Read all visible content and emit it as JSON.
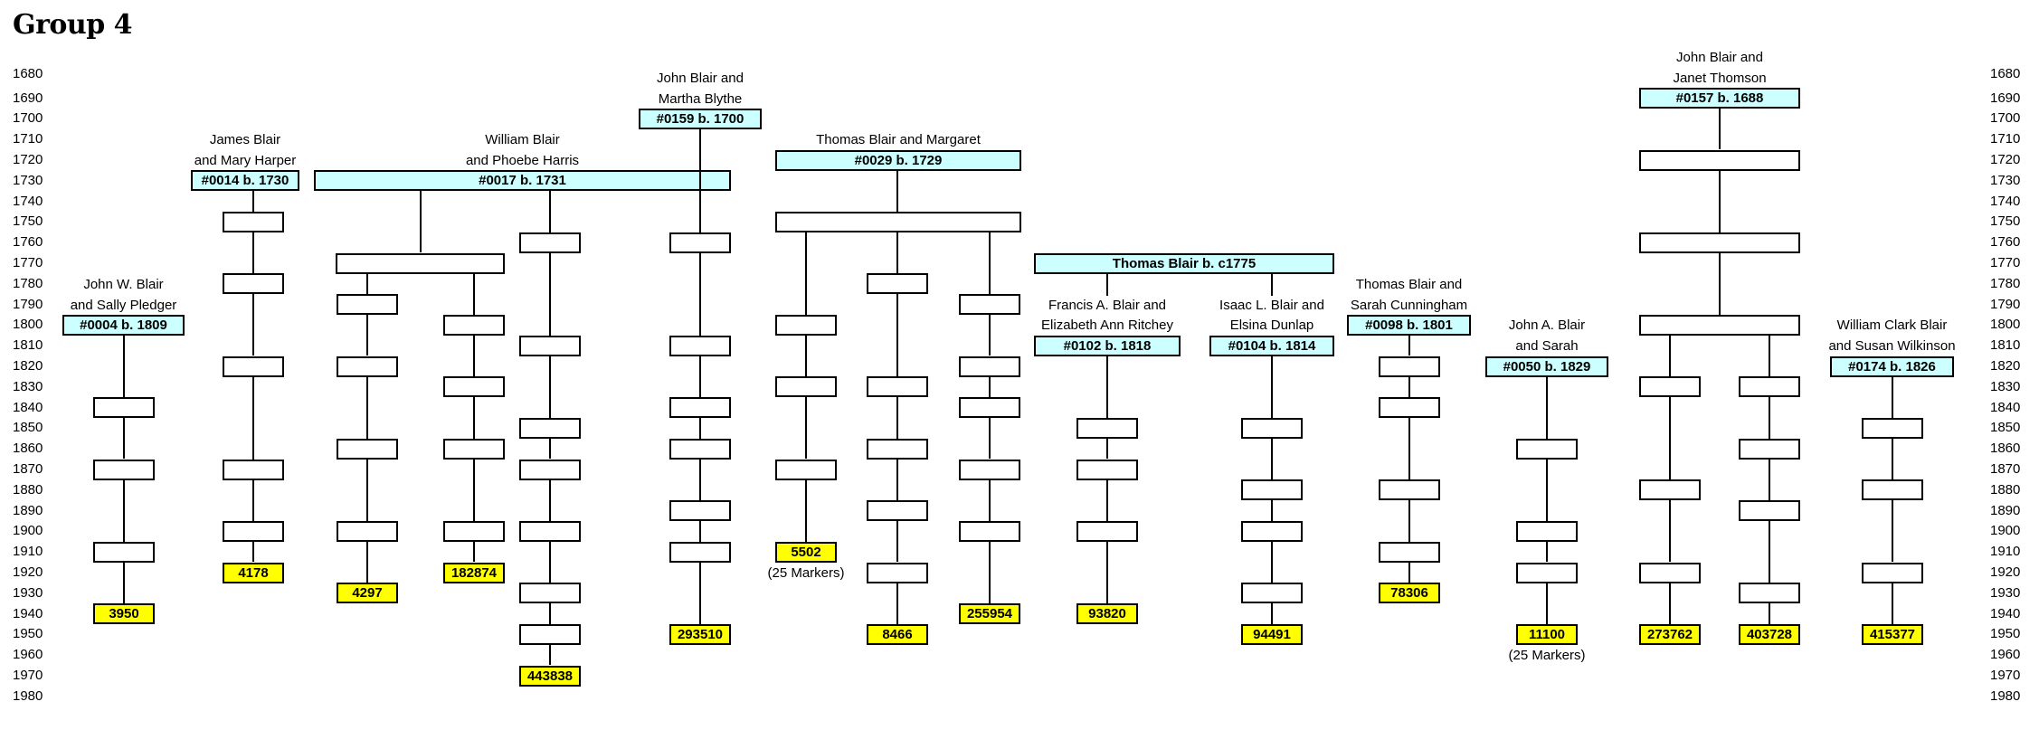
{
  "title": "Group 4",
  "years": [
    1680,
    1690,
    1700,
    1710,
    1720,
    1730,
    1740,
    1750,
    1760,
    1770,
    1780,
    1790,
    1800,
    1810,
    1820,
    1830,
    1840,
    1850,
    1860,
    1870,
    1880,
    1890,
    1900,
    1910,
    1920,
    1930,
    1940,
    1950,
    1960,
    1970,
    1980
  ],
  "colors": {
    "person_fill": "#ccffff",
    "kit_fill": "#ffff00",
    "generation_fill": "#ffffff",
    "line": "#000000"
  },
  "lineages": [
    {
      "id": "c1",
      "couple": [
        "John W. Blair",
        "and Sally Pledger"
      ],
      "ancestor": "#0004 b. 1809",
      "ancestor_year": 1800,
      "label_years": [
        1780,
        1790
      ],
      "generations": [
        1840,
        1870,
        1910
      ],
      "kit": "3950",
      "kit_year": 1940
    },
    {
      "id": "c2",
      "couple": [
        "James Blair",
        "and Mary Harper"
      ],
      "ancestor": "#0014 b. 1730",
      "ancestor_year": 1730,
      "label_years": [
        1710,
        1720
      ],
      "generations": [
        1750,
        1780,
        1820,
        1870,
        1900
      ],
      "kit": "4178",
      "kit_year": 1920
    },
    {
      "id": "g0017",
      "couple": [
        "William Blair",
        "and Phoebe Harris"
      ],
      "ancestor": "#0017 b. 1731",
      "ancestor_year": 1730,
      "label_years": [
        1710,
        1720
      ],
      "split_year": 1770,
      "branches": [
        {
          "id": "c3",
          "generations": [
            1790,
            1820,
            1860,
            1900
          ],
          "kit": "4297",
          "kit_year": 1930
        },
        {
          "id": "c4",
          "generations": [
            1800,
            1830,
            1860,
            1900
          ],
          "kit": "182874",
          "kit_year": 1920
        }
      ],
      "direct": {
        "id": "c5",
        "generations": [
          1760,
          1810,
          1850,
          1870,
          1900,
          1930,
          1950
        ],
        "kit": "443838",
        "kit_year": 1970
      }
    },
    {
      "id": "c6",
      "couple": [
        "John Blair and",
        "Martha Blythe"
      ],
      "ancestor": "#0159 b. 1700",
      "ancestor_year": 1700,
      "label_years": [
        1680,
        1690
      ],
      "generations": [
        1760,
        1810,
        1840,
        1860,
        1890,
        1910
      ],
      "kit": "293510",
      "kit_year": 1950
    },
    {
      "id": "g0029",
      "couple": [
        "Thomas Blair and Margaret"
      ],
      "ancestor": "#0029 b. 1729",
      "ancestor_year": 1720,
      "label_years": [
        1710
      ],
      "split_year": 1750,
      "branches": [
        {
          "id": "c7",
          "generations": [
            1800,
            1830,
            1870
          ],
          "kit": "5502",
          "kit_year": 1910,
          "note": "(25 Markers)"
        },
        {
          "id": "c8",
          "generations": [
            1780,
            1830,
            1860,
            1890,
            1920
          ],
          "kit": "8466",
          "kit_year": 1950
        },
        {
          "id": "c9",
          "generations": [
            1790,
            1820,
            1840,
            1870,
            1900
          ],
          "kit": "255954",
          "kit_year": 1940
        }
      ]
    },
    {
      "id": "gc1775",
      "ancestor": "Thomas Blair b. c1775",
      "ancestor_year": 1770,
      "children": [
        {
          "id": "c10",
          "couple": [
            "Francis A. Blair and",
            "Elizabeth Ann Ritchey"
          ],
          "ancestor": "#0102 b. 1818",
          "ancestor_year": 1810,
          "label_years": [
            1790,
            1800
          ],
          "generations": [
            1850,
            1870,
            1900
          ],
          "kit": "93820",
          "kit_year": 1940
        },
        {
          "id": "c11",
          "couple": [
            "Isaac L. Blair and",
            "Elsina Dunlap"
          ],
          "ancestor": "#0104 b. 1814",
          "ancestor_year": 1810,
          "label_years": [
            1790,
            1800
          ],
          "generations": [
            1850,
            1880,
            1900,
            1930
          ],
          "kit": "94491",
          "kit_year": 1950
        }
      ]
    },
    {
      "id": "c12",
      "couple": [
        "Thomas Blair and",
        "Sarah Cunningham"
      ],
      "ancestor": "#0098 b. 1801",
      "ancestor_year": 1800,
      "label_years": [
        1780,
        1790
      ],
      "generations": [
        1820,
        1840,
        1880,
        1910
      ],
      "kit": "78306",
      "kit_year": 1930
    },
    {
      "id": "c13",
      "couple": [
        "John A. Blair",
        "and Sarah"
      ],
      "ancestor": "#0050 b. 1829",
      "ancestor_year": 1820,
      "label_years": [
        1800,
        1810
      ],
      "generations": [
        1860,
        1900,
        1920
      ],
      "kit": "11100",
      "kit_year": 1950,
      "note": "(25 Markers)"
    },
    {
      "id": "g0157",
      "couple": [
        "John Blair and",
        "Janet Thomson"
      ],
      "ancestor": "#0157 b. 1688",
      "ancestor_year": 1690,
      "label_years": [
        1670,
        1680
      ],
      "trunk": [
        1720,
        1760
      ],
      "split_year": 1800,
      "branches": [
        {
          "id": "c14",
          "generations": [
            1830,
            1880,
            1920
          ],
          "kit": "273762",
          "kit_year": 1950
        },
        {
          "id": "c15",
          "generations": [
            1830,
            1860,
            1890,
            1930
          ],
          "kit": "403728",
          "kit_year": 1950
        }
      ]
    },
    {
      "id": "c16",
      "couple": [
        "William Clark Blair",
        "and Susan Wilkinson"
      ],
      "ancestor": "#0174 b. 1826",
      "ancestor_year": 1820,
      "label_years": [
        1800,
        1810
      ],
      "generations": [
        1850,
        1880,
        1920
      ],
      "kit": "415377",
      "kit_year": 1950
    }
  ]
}
